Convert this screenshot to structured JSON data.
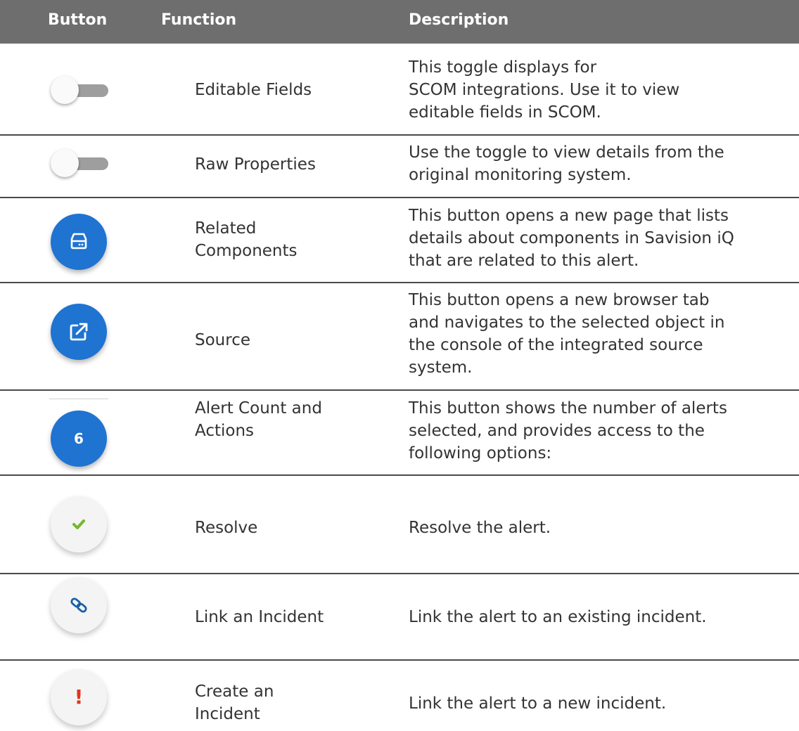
{
  "table": {
    "headers": {
      "button": "Button",
      "function": "Function",
      "description": "Description"
    },
    "rows": [
      {
        "icon": "toggle-switch-off",
        "function_lines": [
          "Editable Fields"
        ],
        "description_lines": [
          "This toggle displays for",
          "SCOM integrations. Use it to view",
          "editable fields in SCOM."
        ]
      },
      {
        "icon": "toggle-switch-off",
        "function_lines": [
          "Raw Properties"
        ],
        "description_lines": [
          "Use the toggle to view details from the",
          "original monitoring system."
        ]
      },
      {
        "icon": "storage-drive-icon",
        "function_lines": [
          "Related",
          "Components"
        ],
        "description_lines": [
          "This button opens a new page that lists",
          "details about components in Savision iQ",
          "that are related to this alert."
        ]
      },
      {
        "icon": "open-in-new-icon",
        "function_lines": [
          "Source"
        ],
        "description_lines": [
          "This button opens a new browser tab",
          "and navigates to the selected object in",
          "the console of the integrated source",
          "system."
        ]
      },
      {
        "icon": "alert-count-badge",
        "badge_value": "6",
        "function_lines": [
          "Alert Count and",
          "Actions"
        ],
        "description_lines": [
          "This button shows the number of alerts",
          "selected, and provides access to the",
          "following options:"
        ]
      },
      {
        "icon": "checkmark-icon",
        "function_lines": [
          "Resolve"
        ],
        "description_lines": [
          "Resolve the alert."
        ]
      },
      {
        "icon": "link-icon",
        "function_lines": [
          "Link an Incident"
        ],
        "description_lines": [
          "Link the alert to an existing incident."
        ]
      },
      {
        "icon": "exclamation-icon",
        "badge_value": "!",
        "function_lines": [
          "Create an",
          "Incident"
        ],
        "description_lines": [
          "Link the alert to a new incident."
        ]
      }
    ]
  },
  "colors": {
    "header_bg": "#6e6e6e",
    "fab_blue": "#1f73d1",
    "check_green": "#76b72a",
    "link_blue": "#1a5fa8",
    "exclamation_red": "#e1341e"
  }
}
